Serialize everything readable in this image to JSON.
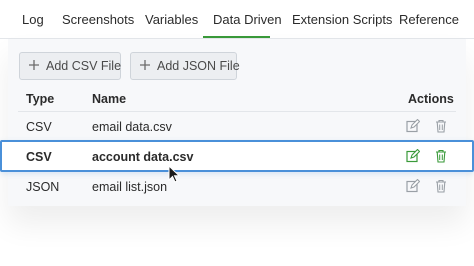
{
  "tabs": [
    {
      "label": "Log"
    },
    {
      "label": "Screenshots"
    },
    {
      "label": "Variables"
    },
    {
      "label": "Data Driven"
    },
    {
      "label": "Extension Scripts"
    },
    {
      "label": "Reference"
    }
  ],
  "active_tab": "Data Driven",
  "toolbar": {
    "add_csv_label": "Add CSV File",
    "add_json_label": "Add JSON File"
  },
  "table": {
    "headers": {
      "type": "Type",
      "name": "Name",
      "actions": "Actions"
    },
    "rows": [
      {
        "type": "CSV",
        "name": "email data.csv"
      },
      {
        "type": "CSV",
        "name": "account data.csv"
      },
      {
        "type": "JSON",
        "name": "email list.json"
      }
    ],
    "selected_row": 1
  },
  "icons": {
    "edit": "edit-icon",
    "delete": "trash-icon",
    "add": "plus-icon",
    "cursor": "mouse-pointer-icon"
  },
  "colors": {
    "accent_green": "#3a9a3a",
    "selection_blue": "#4a90d9",
    "icon_gray": "#9aa0a6"
  }
}
